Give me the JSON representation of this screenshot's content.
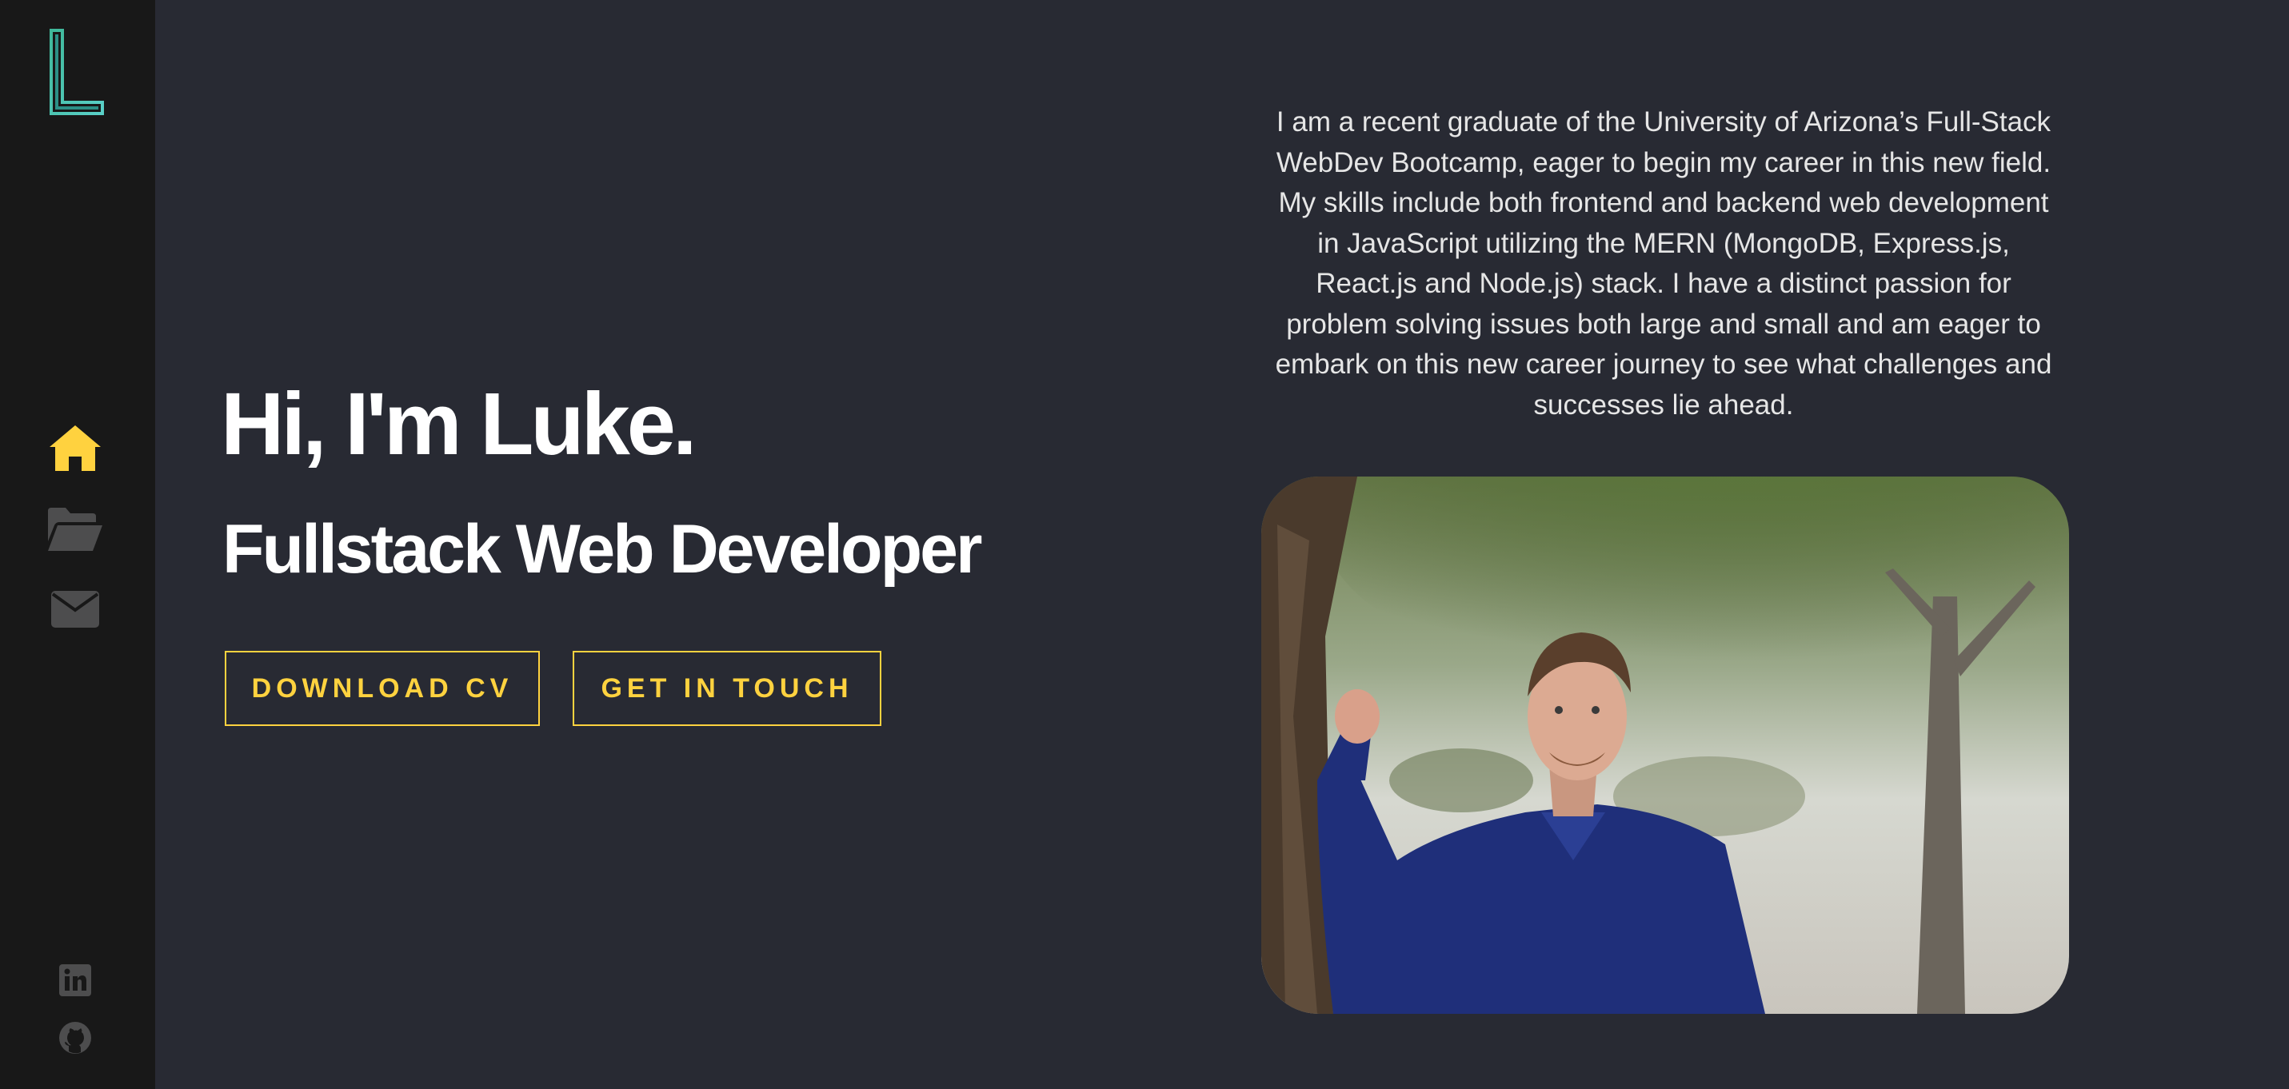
{
  "sidebar": {
    "logo_letter": "L",
    "nav": [
      {
        "name": "home",
        "icon": "home-icon",
        "active": true
      },
      {
        "name": "projects",
        "icon": "folder-open-icon",
        "active": false
      },
      {
        "name": "contact",
        "icon": "envelope-icon",
        "active": false
      }
    ],
    "social": [
      {
        "name": "linkedin",
        "icon": "linkedin-icon"
      },
      {
        "name": "github",
        "icon": "github-icon"
      }
    ]
  },
  "hero": {
    "title": "Hi, I'm Luke.",
    "subtitle": "Fullstack Web Developer",
    "buttons": {
      "download_cv": "DOWNLOAD CV",
      "get_in_touch": "GET IN TOUCH"
    }
  },
  "about": {
    "bio": "I am a recent graduate of the University of Arizona’s Full-Stack WebDev Bootcamp, eager to begin my career in this new field. My skills include both frontend and backend web development in JavaScript utilizing the MERN (MongoDB, Express.js, React.js and Node.js) stack. I have a distinct passion for problem solving issues both large and small and am eager to embark on this new career journey to see what challenges and successes lie ahead."
  },
  "colors": {
    "background": "#282a33",
    "sidebar": "#181818",
    "accent": "#ffd23f",
    "icon_muted": "#4d4d4e",
    "logo_teal": "#3fb8a8"
  }
}
